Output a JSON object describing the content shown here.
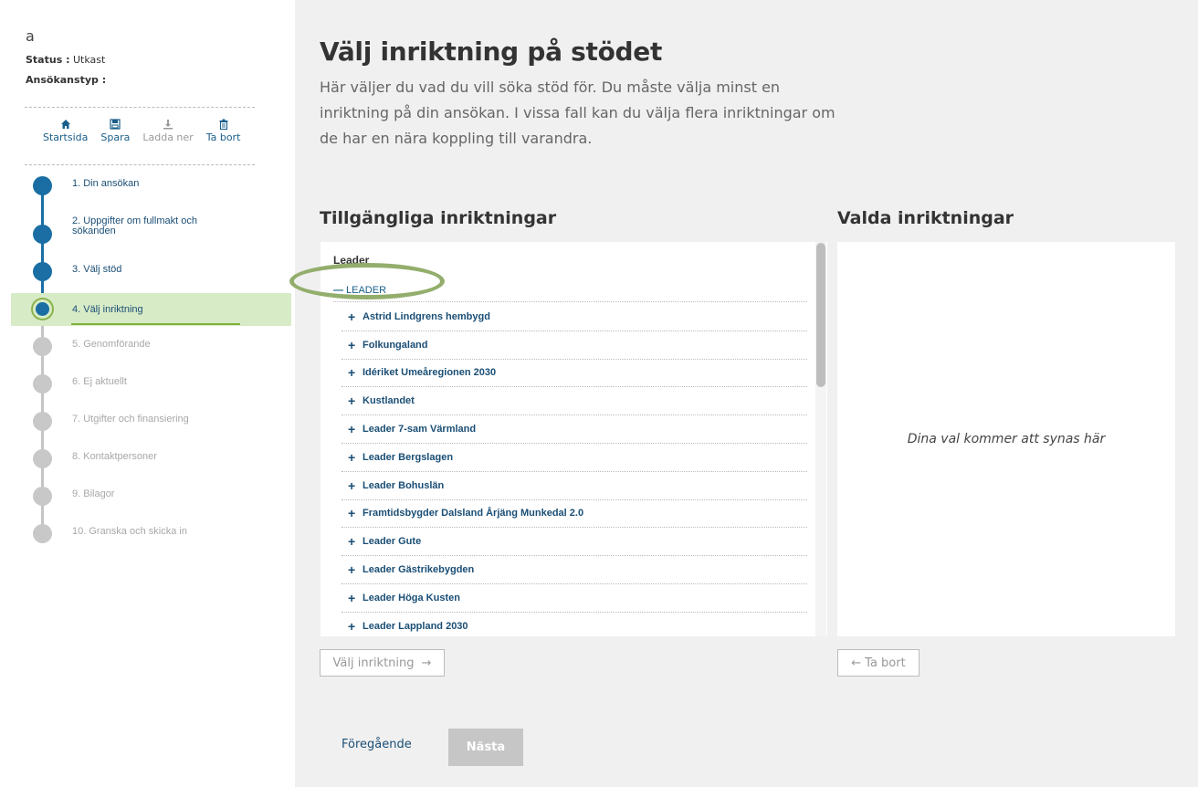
{
  "app": {
    "name": "a",
    "status_label": "Status :",
    "status_value": "Utkast",
    "type_label": "Ansökanstyp :"
  },
  "toolbar": {
    "home": "Startsida",
    "save": "Spara",
    "download": "Ladda ner",
    "delete": "Ta bort"
  },
  "steps": [
    {
      "label": "1. Din ansökan",
      "state": "done"
    },
    {
      "label": "2. Uppgifter om fullmakt och sökanden",
      "state": "done"
    },
    {
      "label": "3. Välj stöd",
      "state": "done"
    },
    {
      "label": "4. Välj inriktning",
      "state": "active"
    },
    {
      "label": "5. Genomförande",
      "state": "pending"
    },
    {
      "label": "6. Ej aktuellt",
      "state": "pending"
    },
    {
      "label": "7. Utgifter och finansiering",
      "state": "pending"
    },
    {
      "label": "8. Kontaktpersoner",
      "state": "pending"
    },
    {
      "label": "9. Bilagor",
      "state": "pending"
    },
    {
      "label": "10. Granska och skicka in",
      "state": "pending"
    }
  ],
  "main": {
    "title": "Välj inriktning på stödet",
    "intro": "Här väljer du vad du vill söka stöd för. Du måste välja minst en inriktning på din ansökan. I vissa fall kan du välja flera inriktningar om de har en nära koppling till varandra.",
    "available_title": "Tillgängliga inriktningar",
    "selected_title": "Valda inriktningar",
    "group_heading": "Leader",
    "subgroup_label": "LEADER",
    "items": [
      "Astrid Lindgrens hembygd",
      "Folkungaland",
      "Idériket Umeåregionen 2030",
      "Kustlandet",
      "Leader 7-sam Värmland",
      "Leader Bergslagen",
      "Leader Bohuslän",
      "Framtidsbygder Dalsland Årjäng Munkedal 2.0",
      "Leader Gute",
      "Leader Gästrikebygden",
      "Leader Höga Kusten",
      "Leader Lappland 2030"
    ],
    "selected_placeholder": "Dina val kommer att synas här",
    "choose_button": "Välj inriktning",
    "remove_button": "Ta bort",
    "prev_link": "Föregående",
    "next_button": "Nästa"
  },
  "colors": {
    "accent": "#1a6ea3",
    "active_bg": "#d8ebc7",
    "highlight": "#93ae6c"
  }
}
